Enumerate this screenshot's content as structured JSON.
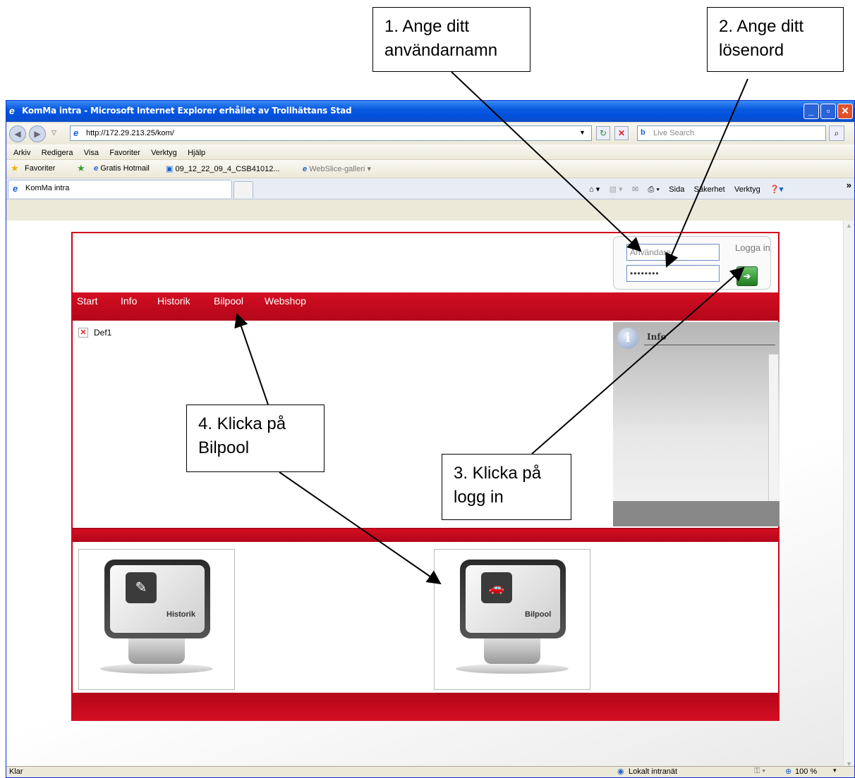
{
  "callouts": {
    "c1": "1. Ange ditt användarnamn",
    "c2": "2. Ange ditt lösenord",
    "c3": "3. Klicka på logg in",
    "c4": "4. Klicka på Bilpool"
  },
  "window": {
    "title": "KomMa intra - Microsoft Internet Explorer erhållet av Trollhättans Stad",
    "address": "http://172.29.213.25/kom/",
    "search_placeholder": "Live Search",
    "menu": [
      "Arkiv",
      "Redigera",
      "Visa",
      "Favoriter",
      "Verktyg",
      "Hjälp"
    ],
    "favorites_label": "Favoriter",
    "fav_links": [
      "Gratis Hotmail",
      "09_12_22_09_4_CSB41012...",
      "WebSlice-galleri"
    ],
    "tab_label": "KomMa intra",
    "commands": [
      "Sida",
      "Säkerhet",
      "Verktyg"
    ],
    "status_text": "Klar",
    "zone": "Lokalt intranät",
    "zoom": "100 %"
  },
  "page": {
    "nav": [
      "Start",
      "Info",
      "Historik",
      "Bilpool",
      "Webshop"
    ],
    "login": {
      "username_placeholder": "Användare",
      "password_value": "••••••••",
      "login_label": "Logga in"
    },
    "broken_item": "Def1",
    "info_title": "Info",
    "tiles": [
      "Historik",
      "Bilpool"
    ]
  },
  "colors": {
    "brand_red": "#d0021b",
    "xp_blue": "#0050dc"
  }
}
